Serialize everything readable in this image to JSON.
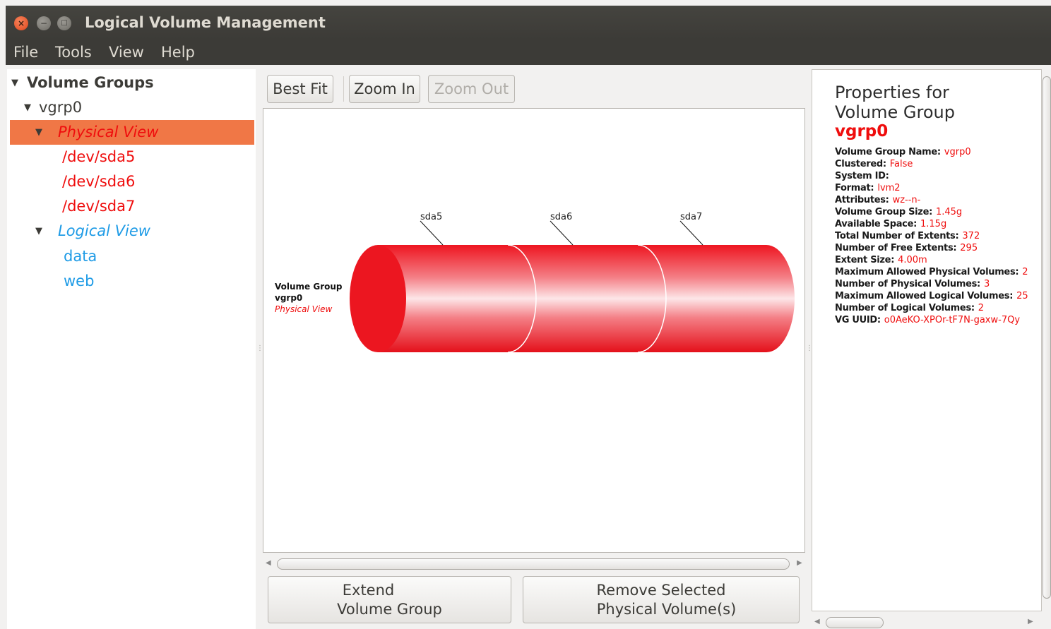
{
  "window": {
    "title": "Logical Volume Management",
    "buttons": {
      "close": "×",
      "minimize": "−",
      "maximize": "□"
    }
  },
  "menu": [
    "File",
    "Tools",
    "View",
    "Help"
  ],
  "tree": {
    "root": "Volume Groups",
    "vg": "vgrp0",
    "physical_view": "Physical View",
    "physical_volumes": [
      "/dev/sda5",
      "/dev/sda6",
      "/dev/sda7"
    ],
    "logical_view": "Logical View",
    "logical_volumes": [
      "data",
      "web"
    ]
  },
  "toolbar": {
    "best_fit": "Best Fit",
    "zoom_in": "Zoom In",
    "zoom_out": "Zoom Out"
  },
  "canvas": {
    "vg_label_line1": "Volume Group",
    "vg_label_line2": "vgrp0",
    "vg_label_line3": "Physical View",
    "segments": [
      "sda5",
      "sda6",
      "sda7"
    ]
  },
  "actions": {
    "extend_line1": "Extend",
    "extend_line2": "Volume Group",
    "remove_line1": "Remove Selected",
    "remove_line2": "Physical Volume(s)"
  },
  "properties": {
    "heading_line1": "Properties for",
    "heading_line2": "Volume Group",
    "vg_name": "vgrp0",
    "rows": [
      {
        "key": "Volume Group Name:",
        "value": "vgrp0"
      },
      {
        "key": "Clustered:",
        "value": "False"
      },
      {
        "key": "System ID:",
        "value": ""
      },
      {
        "key": "Format:",
        "value": "lvm2"
      },
      {
        "key": "Attributes:",
        "value": "wz--n-"
      },
      {
        "key": "Volume Group Size:",
        "value": "1.45g"
      },
      {
        "key": "Available Space:",
        "value": "1.15g"
      },
      {
        "key": "Total Number of Extents:",
        "value": "372"
      },
      {
        "key": "Number of Free Extents:",
        "value": "295"
      },
      {
        "key": "Extent Size:",
        "value": "4.00m"
      },
      {
        "key": "Maximum Allowed Physical Volumes:",
        "value": "2"
      },
      {
        "key": "Number of Physical Volumes:",
        "value": "3"
      },
      {
        "key": "Maximum Allowed Logical Volumes:",
        "value": "25"
      },
      {
        "key": "Number of Logical Volumes:",
        "value": "2"
      },
      {
        "key": "VG UUID:",
        "value": "o0AeKO-XPOr-tF7N-gaxw-7Qy"
      }
    ]
  },
  "colors": {
    "accent_selected": "#f07746",
    "physical": "#ef0d0d",
    "logical": "#1e9be6",
    "titlebar": "#3c3b37"
  }
}
